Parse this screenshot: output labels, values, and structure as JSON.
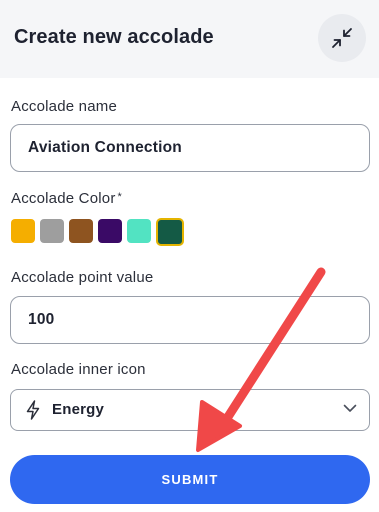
{
  "header": {
    "title": "Create new accolade",
    "collapse_icon": "collapse-arrows-icon"
  },
  "form": {
    "name_label": "Accolade name",
    "name_value": "Aviation Connection",
    "color_label": "Accolade Color",
    "color_required_marker": "*",
    "swatches": [
      {
        "color": "#f5ae00",
        "selected": false
      },
      {
        "color": "#9e9e9e",
        "selected": false
      },
      {
        "color": "#8e5420",
        "selected": false
      },
      {
        "color": "#3a0a66",
        "selected": false
      },
      {
        "color": "#52e3c2",
        "selected": false
      },
      {
        "color": "#145a45",
        "selected": true
      }
    ],
    "point_label": "Accolade point value",
    "point_value": "100",
    "icon_label": "Accolade inner icon",
    "icon_value": "Energy",
    "icon_value_icon": "lightning-bolt-icon",
    "submit_label": "SUBMIT"
  },
  "colors": {
    "accent": "#2f68f0",
    "annotation_arrow": "#f04848",
    "selected_swatch_border": "#e4b400"
  }
}
